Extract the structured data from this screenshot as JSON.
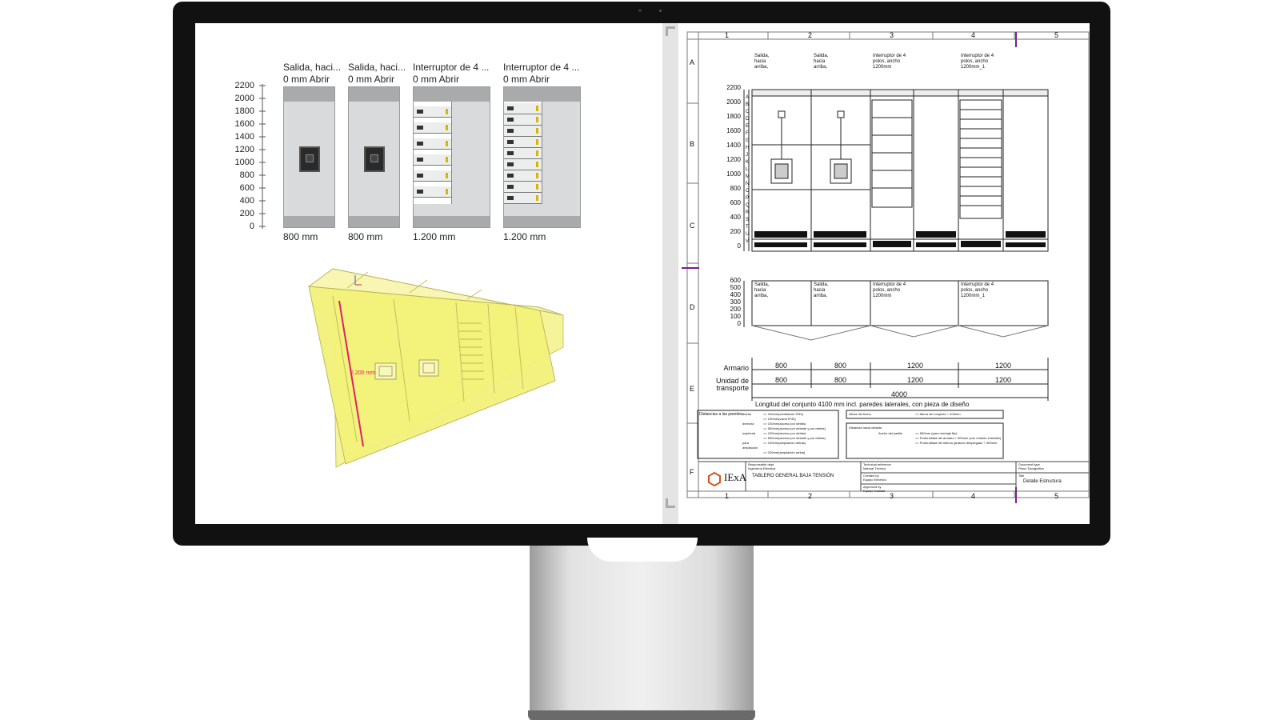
{
  "left_panel": {
    "columns": [
      {
        "name": "Salida, haci...",
        "status": "0 mm Abrir",
        "width": "800 mm"
      },
      {
        "name": "Salida, haci...",
        "status": "0 mm Abrir",
        "width": "800 mm"
      },
      {
        "name": "Interruptor de 4 ...",
        "status": "0 mm Abrir",
        "width": "1.200 mm"
      },
      {
        "name": "Interruptor de 4 ...",
        "status": "0 mm Abrir",
        "width": "1.200 mm"
      }
    ],
    "y_ticks": [
      "2200",
      "2000",
      "1800",
      "1600",
      "1400",
      "1200",
      "1000",
      "800",
      "600",
      "400",
      "200",
      "0"
    ],
    "model_dimension": "2.200 mm"
  },
  "drawing": {
    "col_numbers": [
      "1",
      "2",
      "3",
      "4",
      "5"
    ],
    "row_letters": [
      "A",
      "B",
      "C",
      "D",
      "E",
      "F"
    ],
    "headers": [
      {
        "l1": "Salida,",
        "l2": "hacia",
        "l3": "arriba,"
      },
      {
        "l1": "Salida,",
        "l2": "hacia",
        "l3": "arriba,"
      },
      {
        "l1": "Interruptor de 4",
        "l2": "polos, ancho",
        "l3": "1200mm"
      },
      {
        "l1": "Interruptor de 4",
        "l2": "polos, ancho",
        "l3": "1200mm_1"
      }
    ],
    "front_ticks": [
      "2200",
      "2000",
      "1800",
      "1600",
      "1400",
      "1200",
      "1000",
      "800",
      "600",
      "400",
      "200",
      "0"
    ],
    "row_codes": [
      "A",
      "B",
      "C",
      "D",
      "E",
      "F",
      "G",
      "H",
      "J",
      "K",
      "L",
      "M",
      "N",
      "O",
      "P",
      "Q",
      "R",
      "S",
      "T",
      "U",
      "V"
    ],
    "plan_ticks": [
      "600",
      "500",
      "400",
      "300",
      "200",
      "100",
      "0"
    ],
    "armario_label": "Armario",
    "armario_values": [
      "800",
      "800",
      "1200",
      "1200"
    ],
    "transport_label_1": "Unidad de",
    "transport_label_2": "transporte",
    "transport_values": [
      "800",
      "800",
      "1200",
      "1200"
    ],
    "total": "4000",
    "length_note": "Longitud del conjunto 4100 mm incl. paredes laterales, con pieza de diseño",
    "distances_title": "Distancias a las paredes",
    "distances": [
      {
        "k": "detrás",
        "v": "=> 100mm(ventilación IP40)"
      },
      {
        "k": "",
        "v": "=> 100mm(vacío IP40)"
      },
      {
        "k": "derecha",
        "v": "=> 100mm(acceso por detrás)"
      },
      {
        "k": "",
        "v": "=> 500mm(acceso por delante y por detrás)"
      },
      {
        "k": "izquierda",
        "v": "=> 100mm(acceso por detrás)"
      },
      {
        "k": "",
        "v": "=> 500mm(acceso por delante y por detrás)"
      },
      {
        "k": "para ampliación",
        "v": "=> 100mm(ampliación detrás)"
      },
      {
        "k": "",
        "v": "=> 100mm(ampliación arriba)"
      }
    ],
    "ceiling_label": "Altura del techo",
    "ceiling_value": "=> Altura del conjunto + 400mm",
    "corridor_title": "Distancia hacia delante",
    "corridor_label": "Ancho del pasillo",
    "corridor_values": [
      "=> 800mm (para montaje fijo)",
      "=> Profundidad del armario + 500mm (con módulo extraíble)",
      "=> Profundidad del interno giratorio desplegado + 500mm"
    ],
    "logo": "IExA",
    "resp_label": "Responsable dept.",
    "resp_value": "Ingeniería Eléctrica",
    "project": "TABLERO GENERAL BAJA TENSIÓN",
    "tech_label": "Technical reference",
    "tech_value": "Manual Técnico",
    "created_label": "Created by",
    "created_value": "Equipo Eléctrico",
    "approved_label": "Approved by",
    "approved_value": "Equipo Calidad",
    "doctype_label": "Document type",
    "doctype_value": "Plano Topográfico",
    "title_label": "Title",
    "title_value": "Detalle Estructura"
  },
  "colors": {
    "accent": "#7a1f8a",
    "model_fill": "#f3f27a",
    "dimension": "#e0206a"
  }
}
